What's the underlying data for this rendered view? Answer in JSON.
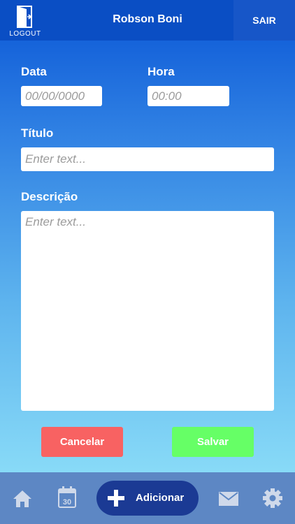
{
  "header": {
    "logout_label": "LOGOUT",
    "user_name": "Robson Boni",
    "exit_label": "SAIR"
  },
  "form": {
    "date_label": "Data",
    "date_placeholder": "00/00/0000",
    "time_label": "Hora",
    "time_placeholder": "00:00",
    "title_label": "Título",
    "title_placeholder": "Enter text...",
    "description_label": "Descrição",
    "description_placeholder": "Enter text..."
  },
  "actions": {
    "cancel_label": "Cancelar",
    "save_label": "Salvar"
  },
  "tabbar": {
    "add_label": "Adicionar",
    "calendar_day": "30",
    "icons": [
      "home-icon",
      "calendar-icon",
      "plus-icon",
      "mail-icon",
      "gear-icon"
    ]
  },
  "colors": {
    "header": "#0a4ec4",
    "exit_button": "#1756c8",
    "cancel": "#f86262",
    "save": "#66ff66",
    "tabbar": "#5d87c4",
    "add_pill": "#1b3a94",
    "tab_icon": "#cfd9ea"
  }
}
